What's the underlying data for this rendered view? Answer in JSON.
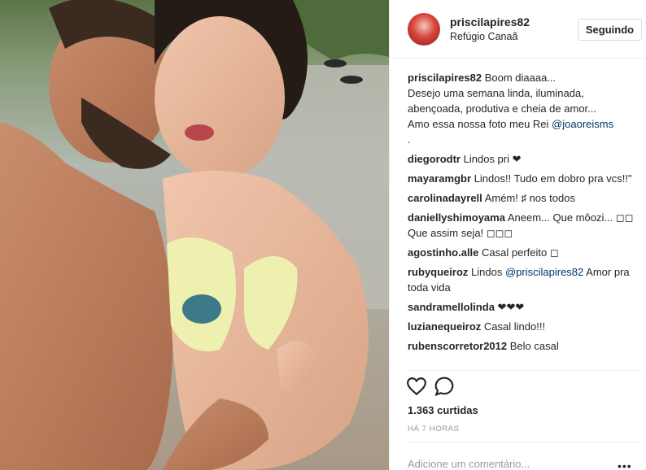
{
  "post": {
    "photo_icon": "photo-content"
  },
  "header": {
    "username": "priscilapires82",
    "location": "Refúgio Canaã",
    "follow_label": "Seguindo"
  },
  "caption": {
    "user": "priscilapires82",
    "lines": [
      "Boom diaaaa...",
      "Desejo uma semana linda, iluminada,",
      "abençoada, produtiva e cheia de amor...",
      "Amo essa nossa foto meu Rei"
    ],
    "mention": "@joaoreisms",
    "trailing": "."
  },
  "comments": [
    {
      "user": "diegorodtr",
      "text": "Lindos pri ❤"
    },
    {
      "user": "mayaramgbr",
      "text": "Lindos!! Tudo em dobro pra vcs!!\""
    },
    {
      "user": "carolinadayrell",
      "text": "Amém! ♯ nos todos"
    },
    {
      "user": "daniellyshimoyama",
      "text": "Aneem... Que môozi... ◻◻ Que assim seja! ◻◻◻"
    },
    {
      "user": "agostinho.alle",
      "text": "Casal perfeito ◻"
    },
    {
      "user": "rubyqueiroz",
      "text_before": "Lindos",
      "mention": "@priscilapires82",
      "text_after": "Amor pra toda vida"
    },
    {
      "user": "sandramellolinda",
      "text": "❤❤❤"
    },
    {
      "user": "luzianequeiroz",
      "text": "Casal lindo!!!"
    },
    {
      "user": "rubenscorretor2012",
      "text": "Belo casal"
    }
  ],
  "actions": {
    "like_icon": "heart-outline-icon",
    "comment_icon": "speech-bubble-icon"
  },
  "likes": "1.363 curtidas",
  "timestamp": "HÁ 7 HORAS",
  "comment_box": {
    "placeholder": "Adicione um comentário...",
    "more_label": "•••"
  },
  "colors": {
    "text": "#262626",
    "mention": "#003569",
    "muted": "#999999",
    "border": "#dbdbdb",
    "divider": "#efefef"
  }
}
